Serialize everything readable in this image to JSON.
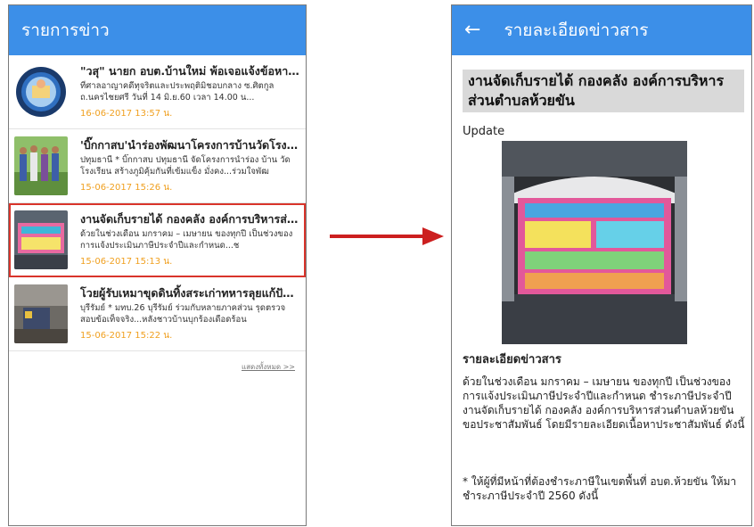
{
  "left_screen": {
    "title": "รายการข่าว",
    "items": [
      {
        "title": "\"วสุ\" นายก อบต.บ้านใหม่ พ้อเจอแจ้งข้อหาอี...",
        "snippet": "ที่ศาลอาญาคดีทุจริตและประพฤติมิชอบกลาง ซ.ศิตกูล ถ.นครไชยศรี วันที่ 14 มิ.ย.60 เวลา 14.00 น...",
        "date": "16-06-2017  13:57 น.",
        "thumb_icon": "reader-logo-icon"
      },
      {
        "title": "'บิ๊กกาสบ'นำร่องพัฒนาโครงการบ้านวัดโรงเ...",
        "snippet": "ปทุมธานี * บิ๊กกาสบ ปทุมธานี จัดโครงการนำร่อง บ้าน วัด โรงเรียน สร้างภูมิคุ้มกันที่เข้มแข็ง มั่งคง...ร่วมใจพัฒ",
        "date": "15-06-2017  15:26 น.",
        "thumb_icon": "group-photo-icon"
      },
      {
        "title": "งานจัดเก็บรายได้ กองคลัง องค์การบริหารส่ว...",
        "snippet": "ด้วยในช่วงเดือน มกราคม – เมษายน ของทุกปี เป็นช่วงของการแจ้งประเมินภาษีประจำปีและกำหนด...ช",
        "date": "15-06-2017  15:13 น.",
        "thumb_icon": "banner-photo-icon"
      },
      {
        "title": "โวยผู้รับเหมาขุดดินทิ้งสระเก่าทหารลุยแก้ปัญ...",
        "snippet": "บุรีรัมย์ * มทบ.26 บุรีรัมย์ ร่วมกับหลายภาคส่วน รุดตรวจสอบข้อเท็จจริง...หลังชาวบ้านบุกร้องเดือดร้อน",
        "date": "15-06-2017  15:22 น.",
        "thumb_icon": "site-photo-icon"
      }
    ],
    "more_link": "แสดงทั้งหมด >>"
  },
  "right_screen": {
    "title": "รายละเอียดข่าวสาร",
    "back_icon": "back-arrow-icon",
    "headline": "งานจัดเก็บรายได้ กองคลัง องค์การบริหารส่วนตำบลห้วยขัน",
    "update_label": "Update",
    "section_heading": "รายละเอียดข่าวสาร",
    "body_paragraph": "ด้วยในช่วงเดือน มกราคม – เมษายน ของทุกปี เป็นช่วงของการแจ้งประเมินภาษีประจำปีและกำหนด ชำระภาษีประจำปี งานจัดเก็บรายได้ กองคลัง องค์การบริหารส่วนตำบลห้วยขัน ขอประชาสัมพันธ์ โดยมีรายละเอียดเนื้อหาประชาสัมพันธ์ ดังนี้",
    "note_paragraph": "* ให้ผู้ที่มีหน้าที่ต้องชำระภาษีในเขตพื้นที่ อบต.ห้วยขัน ให้มาชำระภาษีประจำปี 2560 ดังนี้"
  },
  "colors": {
    "appbar": "#3c8fe8",
    "date": "#f0a020",
    "selection": "#d9342b",
    "arrow": "#cc1f1f"
  }
}
